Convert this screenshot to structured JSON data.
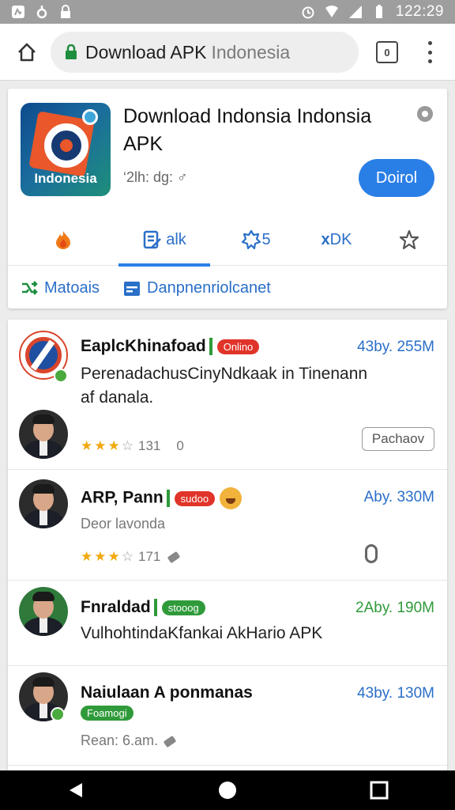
{
  "status_bar": {
    "time": "122:29"
  },
  "browser": {
    "url_main": "Download APK",
    "url_rest": "Indonesia",
    "tab_count": "0"
  },
  "app": {
    "title": "Download Indonsia Indonsia APK",
    "icon_label": "Indonesia",
    "meta": "‘2lh: dg: ♂",
    "download_label": "Doirol",
    "tabs": [
      {
        "label": "",
        "icon": "flame-icon"
      },
      {
        "label": "alk",
        "icon": "edit-icon"
      },
      {
        "label": "5",
        "icon": "badge-icon"
      },
      {
        "label": "DK",
        "icon": "close-icon"
      },
      {
        "label": "",
        "icon": "star-icon"
      }
    ],
    "links": [
      {
        "label": "Matoais",
        "icon": "shuffle-icon"
      },
      {
        "label": "Danpnenriolcanet",
        "icon": "calendar-icon"
      }
    ]
  },
  "list": [
    {
      "title": "EaplcKhinafoad",
      "badge": "Onlino",
      "size": "43by. 255M",
      "desc_line1": "PerenadachusCinyNdkaak in Tinenann",
      "desc_line2": "af danala.",
      "rating": "131",
      "rating_extra": "0",
      "preview_label": "Pachaov"
    },
    {
      "title": "ARP, Pann",
      "badge": "sudoo",
      "size": "Aby. 330M",
      "sub": "Deor lavonda",
      "rating": "171"
    },
    {
      "title": "Fnraldad",
      "badge": "stooog",
      "size": "2Aby. 190M",
      "desc_line1": "VulhohtindaKfankai AkHario APK"
    },
    {
      "title": "Naiulaan A ponmanas",
      "badge": "Foamogi",
      "size": "43by. 130M",
      "sub": "Rean: 6.am."
    }
  ],
  "colors": {
    "accent": "#2a7fe7",
    "badge_red": "#e0342a",
    "badge_green": "#2f9a3a",
    "star": "#f1a90f"
  }
}
